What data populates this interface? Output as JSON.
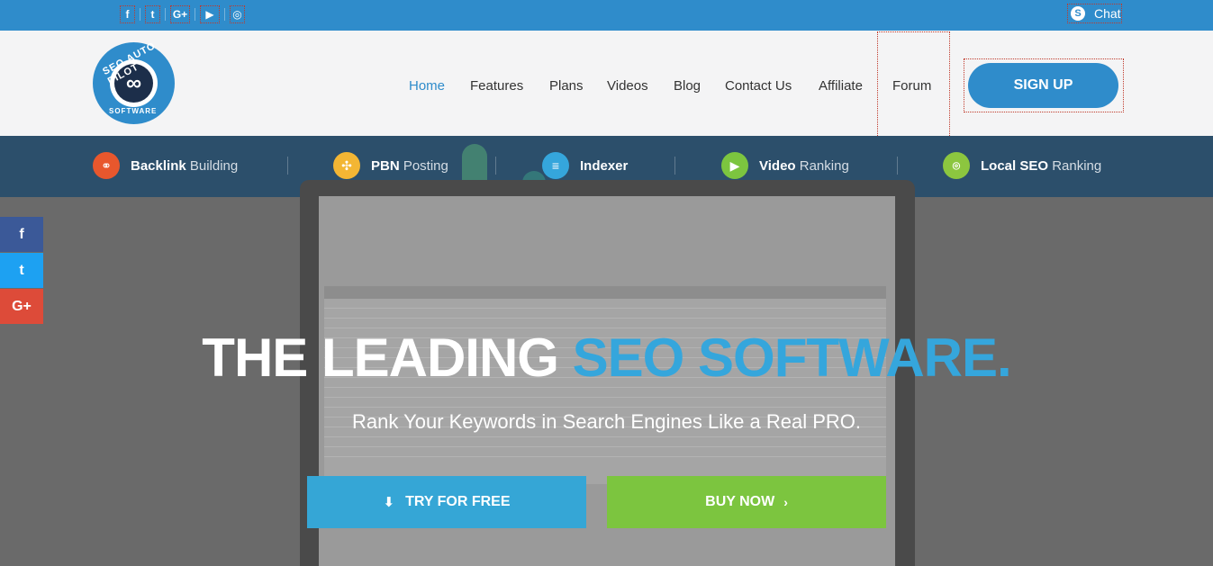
{
  "topbar": {
    "social": [
      {
        "name": "facebook-icon",
        "glyph": "f"
      },
      {
        "name": "twitter-icon",
        "glyph": "t"
      },
      {
        "name": "google-plus-icon",
        "glyph": "G+"
      },
      {
        "name": "youtube-icon",
        "glyph": "▶"
      },
      {
        "name": "instagram-icon",
        "glyph": "◎"
      }
    ],
    "chat_label": "Chat"
  },
  "header": {
    "logo_text_top": "SEO AUTO PILOT",
    "logo_text_bottom": "SOFTWARE",
    "nav": [
      "Home",
      "Features",
      "Plans",
      "Videos",
      "Blog",
      "Contact Us",
      "Affiliate",
      "Forum"
    ],
    "active_nav": "Home",
    "signup_label": "SIGN UP"
  },
  "features": [
    {
      "bold": "Backlink",
      "rest": " Building",
      "icon": "link-icon",
      "color": "#e8572d"
    },
    {
      "bold": "PBN",
      "rest": " Posting",
      "icon": "network-icon",
      "color": "#f3b634"
    },
    {
      "bold": "Indexer",
      "rest": "",
      "icon": "document-icon",
      "color": "#35a6dc"
    },
    {
      "bold": "Video",
      "rest": " Ranking",
      "icon": "video-icon",
      "color": "#7cc53f"
    },
    {
      "bold": "Local SEO",
      "rest": " Ranking",
      "icon": "location-icon",
      "color": "#8cc63f"
    }
  ],
  "side_social": [
    {
      "name": "facebook-share-icon",
      "glyph": "f",
      "color": "#3b5998"
    },
    {
      "name": "twitter-share-icon",
      "glyph": "t",
      "color": "#1da1f2"
    },
    {
      "name": "google-plus-share-icon",
      "glyph": "G+",
      "color": "#dd4b39"
    }
  ],
  "hero": {
    "headline_white": "THE LEADING ",
    "headline_accent": "SEO SOFTWARE.",
    "tagline": "Rank Your Keywords in Search Engines Like a Real PRO.",
    "try_label": "TRY FOR FREE",
    "buy_label": "BUY NOW"
  },
  "colors": {
    "brand_blue": "#2f8ccb",
    "strip": "#2c4f6b",
    "accent": "#35a6dc",
    "buy_green": "#7cc53f"
  }
}
